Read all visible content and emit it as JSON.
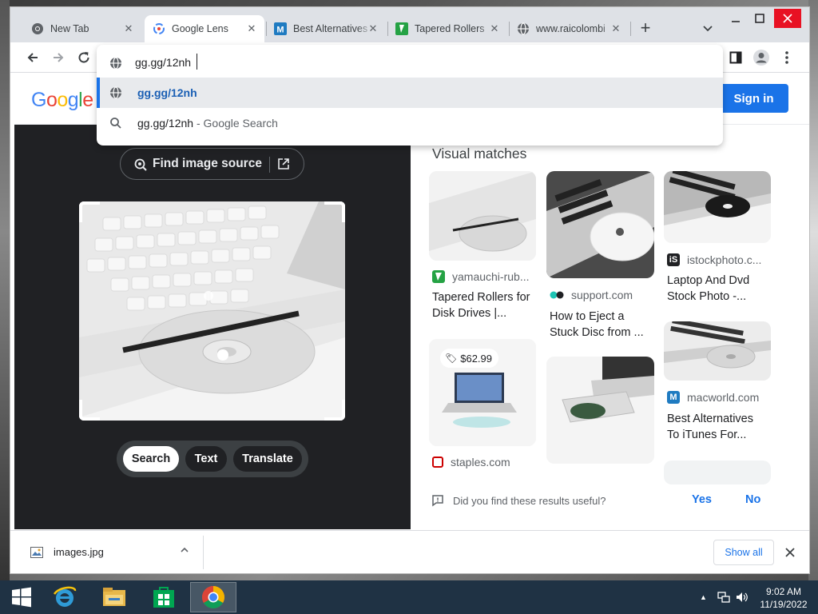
{
  "browser": {
    "tabs": [
      {
        "title": "New Tab",
        "icon": "chrome-icon",
        "active": false
      },
      {
        "title": "Google Lens",
        "icon": "google-lens-icon",
        "active": true
      },
      {
        "title": "Best Alternatives",
        "icon": "macworld-icon",
        "active": false
      },
      {
        "title": "Tapered Rollers",
        "icon": "yamauchi-icon",
        "active": false
      },
      {
        "title": "www.raicolombi",
        "icon": "globe-icon",
        "active": false
      }
    ],
    "new_tab_label": "+",
    "omnibox": {
      "value": "gg.gg/12nh",
      "suggestions": [
        {
          "text": "gg.gg/12nh",
          "suffix": "",
          "icon": "globe-icon"
        },
        {
          "text": "gg.gg/12nh",
          "suffix": " - Google Search",
          "icon": "search-icon"
        }
      ]
    }
  },
  "lens": {
    "logo": "Google",
    "sign_in": "Sign in",
    "find_source": "Find image source",
    "modes": [
      "Search",
      "Text",
      "Translate"
    ],
    "active_mode": "Search",
    "visual_matches_title": "Visual matches",
    "results": [
      {
        "source": "yamauchi-rub...",
        "title1": "Tapered Rollers for",
        "title2": "Disk Drives |...",
        "source_icon": "yamauchi-icon"
      },
      {
        "source": "support.com",
        "title1": "How to Eject a",
        "title2": "Stuck Disc from ...",
        "source_icon": "support-icon"
      },
      {
        "source": "istockphoto.c...",
        "title1": "Laptop And Dvd",
        "title2": "Stock Photo -...",
        "source_icon": "istock-icon"
      },
      {
        "source": "macworld.com",
        "title1": "Best Alternatives",
        "title2": "To iTunes For...",
        "source_icon": "macworld-icon"
      },
      {
        "source": "staples.com",
        "title1": "",
        "title2": "",
        "source_icon": "staples-icon",
        "price": "$62.99"
      }
    ],
    "feedback": {
      "question": "Did you find these results useful?",
      "yes": "Yes",
      "no": "No"
    }
  },
  "downloads": {
    "file": "images.jpg",
    "show_all": "Show all"
  },
  "taskbar": {
    "time": "9:02 AM",
    "date": "11/19/2022"
  },
  "colors": {
    "accent": "#1a73e8",
    "lens_dark": "#202124",
    "taskbar": "#1f3244"
  }
}
